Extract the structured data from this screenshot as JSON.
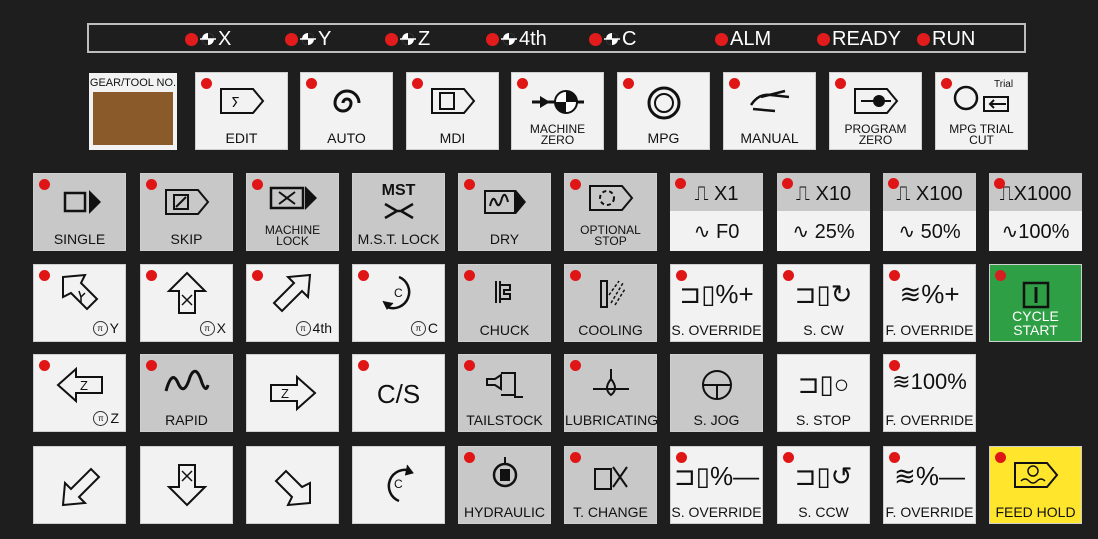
{
  "status": {
    "indicators": [
      {
        "label": "X",
        "glyph": true
      },
      {
        "label": "Y",
        "glyph": true
      },
      {
        "label": "Z",
        "glyph": true
      },
      {
        "label": "4th",
        "glyph": true
      },
      {
        "label": "C",
        "glyph": true
      },
      {
        "label": "ALM",
        "glyph": false
      },
      {
        "label": "READY",
        "glyph": false
      },
      {
        "label": "RUN",
        "glyph": false
      }
    ]
  },
  "gear": {
    "label": "GEAR/TOOL NO."
  },
  "modes": [
    "EDIT",
    "AUTO",
    "MDI",
    "MACHINE ZERO",
    "MPG",
    "MANUAL",
    "PROGRAM ZERO",
    "MPG TRIAL CUT"
  ],
  "mpg_trial_tag": "Trial",
  "row2": {
    "single": "SINGLE",
    "skip": "SKIP",
    "machine_lock": "MACHINE LOCK",
    "mst_lock": "M.S.T. LOCK",
    "mst_top": "MST",
    "dry": "DRY",
    "optional_stop": "OPTIONAL STOP",
    "x1_top": "X1",
    "x1_bot": "F0",
    "x10_top": "X10",
    "x10_bot": "25%",
    "x100_top": "X100",
    "x100_bot": "50%",
    "x1000_top": "X1000",
    "x1000_bot": "100%"
  },
  "row3": {
    "y": "Y",
    "x": "X",
    "fourth": "4th",
    "c": "C",
    "chuck": "CHUCK",
    "cooling": "COOLING",
    "s_override_plus": "S. OVERRIDE",
    "s_cw": "S. CW",
    "f_override_plus": "F. OVERRIDE",
    "cycle_start": "CYCLE START",
    "pct_plus": "%+"
  },
  "row4": {
    "z": "Z",
    "rapid": "RAPID",
    "cs": "C/S",
    "tailstock": "TAILSTOCK",
    "lubricating": "LUBRICATING",
    "s_jog": "S. JOG",
    "s_stop": "S. STOP",
    "f_override_100": "F. OVERRIDE",
    "pct100": "100%"
  },
  "row5": {
    "hydraulic": "HYDRAULIC",
    "t_change": "T. CHANGE",
    "s_override_minus": "S. OVERRIDE",
    "s_ccw": "S. CCW",
    "f_override_minus": "F. OVERRIDE",
    "feed_hold": "FEED HOLD",
    "pct_minus": "%—"
  },
  "colors": {
    "bg": "#1e1e1e",
    "key_white": "#f2f2f2",
    "key_gray": "#c8c8c8",
    "led": "#e01616",
    "cycle_start": "#2f9f45",
    "feed_hold": "#ffe52b"
  }
}
